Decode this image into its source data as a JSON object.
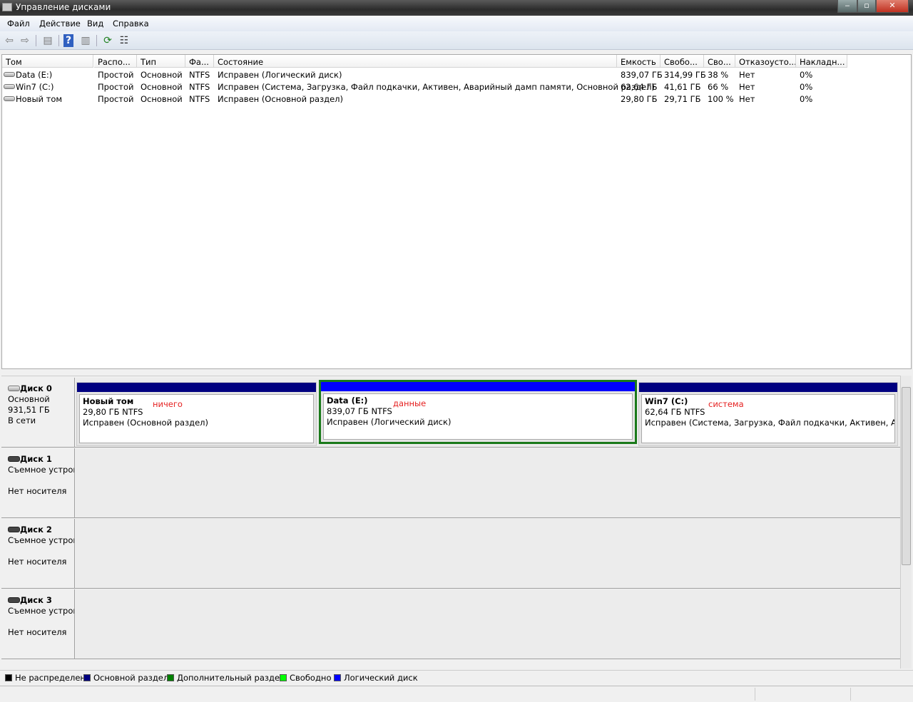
{
  "window": {
    "title": "Управление дисками",
    "min": "‒",
    "max": "▫",
    "close": "✕"
  },
  "menu": [
    "Файл",
    "Действие",
    "Вид",
    "Справка"
  ],
  "toolbar": {
    "back": "⇦",
    "forward": "⇨",
    "console": "▤",
    "help": "?",
    "panel": "▥",
    "refresh": "⟳",
    "properties": "☷"
  },
  "columns": [
    "Том",
    "Распо...",
    "Тип",
    "Фа...",
    "Состояние",
    "Емкость",
    "Свобо...",
    "Сво...",
    "Отказоусто...",
    "Накладн..."
  ],
  "rows": [
    [
      "Data (E:)",
      "Простой",
      "Основной",
      "NTFS",
      "Исправен (Логический диск)",
      "839,07 ГБ",
      "314,99 ГБ",
      "38 %",
      "Нет",
      "0%"
    ],
    [
      "Win7 (C:)",
      "Простой",
      "Основной",
      "NTFS",
      "Исправен (Система, Загрузка, Файл подкачки, Активен, Аварийный дамп памяти, Основной раздел)",
      "62,64 ГБ",
      "41,61 ГБ",
      "66 %",
      "Нет",
      "0%"
    ],
    [
      "Новый том",
      "Простой",
      "Основной",
      "NTFS",
      "Исправен (Основной раздел)",
      "29,80 ГБ",
      "29,71 ГБ",
      "100 %",
      "Нет",
      "0%"
    ]
  ],
  "disks": [
    {
      "name": "Диск 0",
      "type": "Основной",
      "size": "931,51 ГБ",
      "status": "В сети"
    },
    {
      "name": "Диск 1",
      "type": "Съемное устрой",
      "status": "Нет носителя"
    },
    {
      "name": "Диск 2",
      "type": "Съемное устрой",
      "status": "Нет носителя"
    },
    {
      "name": "Диск 3",
      "type": "Съемное устрой",
      "status": "Нет носителя"
    }
  ],
  "partitions": [
    {
      "name": "Новый том",
      "size": "29,80 ГБ NTFS",
      "status": "Исправен (Основной раздел)",
      "note": "ничего",
      "color": "#000080"
    },
    {
      "name": "Data  (E:)",
      "size": "839,07 ГБ NTFS",
      "status": "Исправен (Логический диск)",
      "note": "данные",
      "color": "#0000ff"
    },
    {
      "name": "Win7  (C:)",
      "size": "62,64 ГБ NTFS",
      "status": "Исправен (Система, Загрузка, Файл подкачки, Активен, Аварийный дамп памяти, Основной раздел)",
      "note": "система",
      "color": "#000080"
    }
  ],
  "legend": [
    {
      "label": "Не распределен",
      "color": "#000000"
    },
    {
      "label": "Основной раздел",
      "color": "#000080"
    },
    {
      "label": "Дополнительный раздел",
      "color": "#008000"
    },
    {
      "label": "Свободно",
      "color": "#00ff00"
    },
    {
      "label": "Логический диск",
      "color": "#0000ff"
    }
  ]
}
